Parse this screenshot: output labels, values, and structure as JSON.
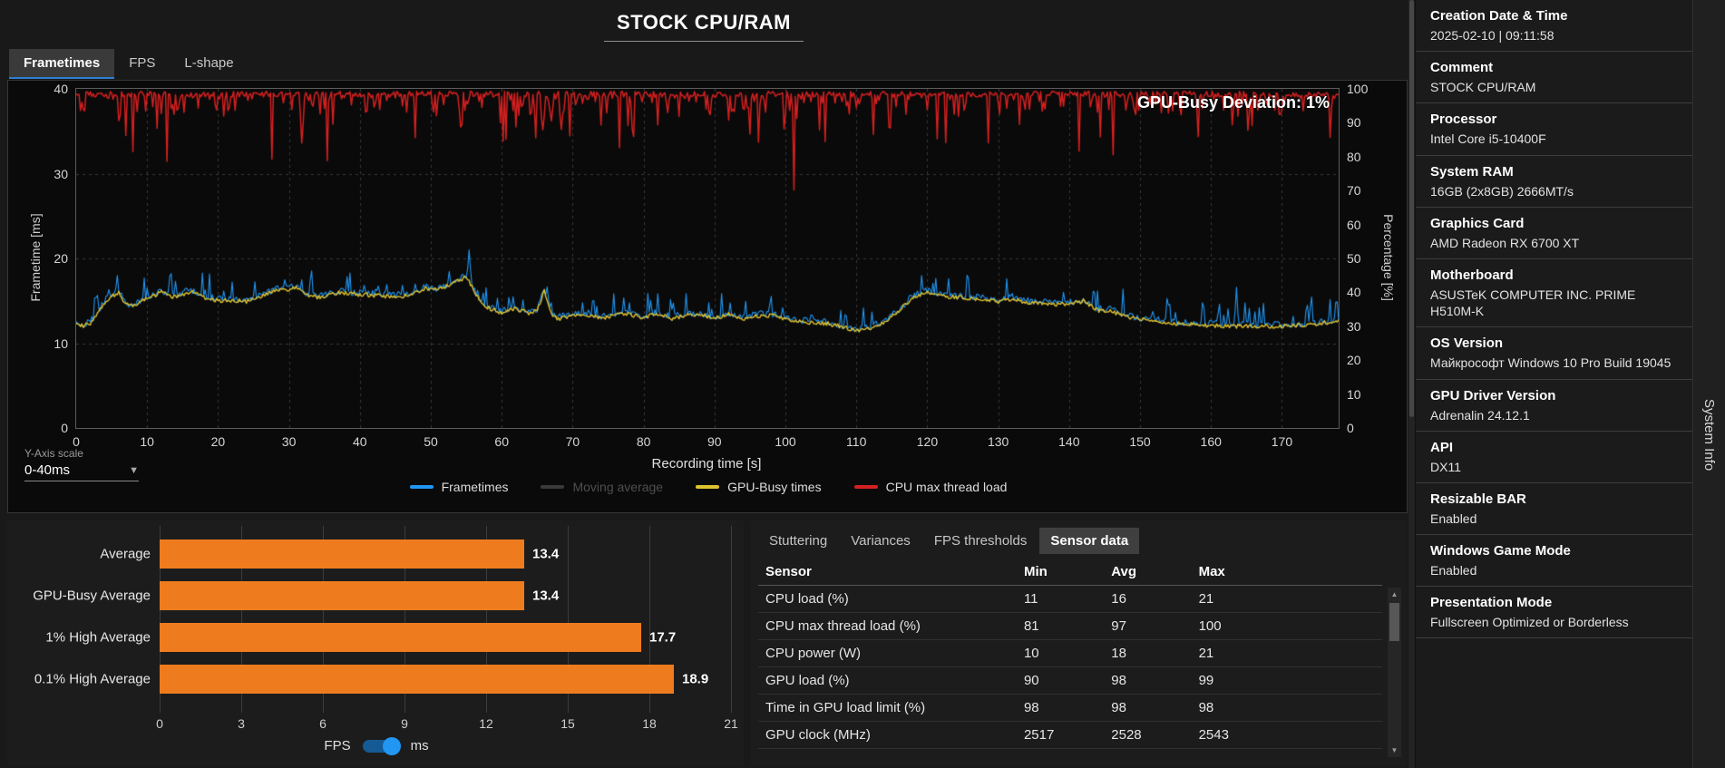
{
  "header": {
    "title": "STOCK CPU/RAM"
  },
  "view_tabs": [
    {
      "label": "Frametimes",
      "active": true
    },
    {
      "label": "FPS",
      "active": false
    },
    {
      "label": "L-shape",
      "active": false
    }
  ],
  "frametime_chart": {
    "type": "line",
    "overlay": "GPU-Busy Deviation: 1%",
    "seed": 20250210,
    "y_left": {
      "label": "Frametime [ms]",
      "ticks": [
        0,
        10,
        20,
        30,
        40
      ],
      "max": 40
    },
    "y_right": {
      "label": "Percentage [%]",
      "ticks": [
        0,
        10,
        20,
        30,
        40,
        50,
        60,
        70,
        80,
        90,
        100
      ],
      "max": 100
    },
    "x": {
      "label": "Recording time [s]",
      "ticks": [
        0,
        10,
        20,
        30,
        40,
        50,
        60,
        70,
        80,
        90,
        100,
        110,
        120,
        130,
        140,
        150,
        160,
        170
      ],
      "max": 178
    },
    "colors": {
      "frametimes": "#2196f3",
      "gpu_busy": "#e0c22e",
      "cpu_load": "#d42020",
      "moving_average": "#3a3a3a",
      "grid": "#383838"
    },
    "legend": [
      {
        "label": "Frametimes",
        "color": "#2196f3",
        "dim": false
      },
      {
        "label": "Moving average",
        "color": "#3a3a3a",
        "dim": true
      },
      {
        "label": "GPU-Busy times",
        "color": "#e0c22e",
        "dim": false
      },
      {
        "label": "CPU max thread load",
        "color": "#d42020",
        "dim": false
      }
    ],
    "baseline": [
      [
        0,
        12.2
      ],
      [
        1,
        12.0
      ],
      [
        2,
        12.4
      ],
      [
        3,
        13.4
      ],
      [
        4,
        14.8
      ],
      [
        5,
        15.6
      ],
      [
        6,
        15.9
      ],
      [
        7,
        14.6
      ],
      [
        8,
        14.3
      ],
      [
        9,
        14.9
      ],
      [
        10,
        15.3
      ],
      [
        12,
        16.0
      ],
      [
        14,
        15.4
      ],
      [
        16,
        16.1
      ],
      [
        18,
        15.4
      ],
      [
        20,
        15.0
      ],
      [
        22,
        15.1
      ],
      [
        24,
        14.9
      ],
      [
        26,
        15.4
      ],
      [
        28,
        16.2
      ],
      [
        30,
        16.3
      ],
      [
        31,
        16.5
      ],
      [
        33,
        15.5
      ],
      [
        35,
        15.4
      ],
      [
        37,
        16.0
      ],
      [
        39,
        15.8
      ],
      [
        41,
        15.7
      ],
      [
        43,
        15.6
      ],
      [
        45,
        15.5
      ],
      [
        47,
        15.6
      ],
      [
        49,
        16.4
      ],
      [
        51,
        16.3
      ],
      [
        53,
        17.0
      ],
      [
        55,
        17.8
      ],
      [
        56,
        16.3
      ],
      [
        57,
        15.0
      ],
      [
        58,
        14.2
      ],
      [
        60,
        13.6
      ],
      [
        62,
        14.1
      ],
      [
        64,
        13.5
      ],
      [
        65,
        13.8
      ],
      [
        66,
        16.2
      ],
      [
        67,
        13.4
      ],
      [
        68,
        12.9
      ],
      [
        70,
        13.2
      ],
      [
        72,
        13.4
      ],
      [
        74,
        12.9
      ],
      [
        76,
        13.3
      ],
      [
        78,
        13.4
      ],
      [
        80,
        13.0
      ],
      [
        82,
        13.5
      ],
      [
        84,
        12.9
      ],
      [
        86,
        13.3
      ],
      [
        88,
        13.4
      ],
      [
        90,
        12.9
      ],
      [
        92,
        13.4
      ],
      [
        94,
        12.9
      ],
      [
        96,
        13.2
      ],
      [
        98,
        13.3
      ],
      [
        100,
        12.9
      ],
      [
        102,
        12.5
      ],
      [
        104,
        12.4
      ],
      [
        106,
        12.3
      ],
      [
        108,
        11.9
      ],
      [
        110,
        11.5
      ],
      [
        112,
        11.8
      ],
      [
        114,
        12.4
      ],
      [
        116,
        13.8
      ],
      [
        118,
        15.4
      ],
      [
        120,
        16.0
      ],
      [
        122,
        15.5
      ],
      [
        124,
        15.4
      ],
      [
        126,
        15.3
      ],
      [
        128,
        15.2
      ],
      [
        130,
        14.9
      ],
      [
        132,
        15.3
      ],
      [
        134,
        14.8
      ],
      [
        136,
        14.7
      ],
      [
        138,
        14.6
      ],
      [
        140,
        14.6
      ],
      [
        142,
        15.0
      ],
      [
        144,
        13.9
      ],
      [
        146,
        13.8
      ],
      [
        148,
        13.1
      ],
      [
        150,
        12.8
      ],
      [
        154,
        12.4
      ],
      [
        158,
        12.2
      ],
      [
        162,
        12.0
      ],
      [
        166,
        12.0
      ],
      [
        170,
        12.0
      ],
      [
        174,
        12.2
      ],
      [
        178,
        12.6
      ]
    ],
    "spikes": [
      [
        5.8,
        18.0
      ],
      [
        55.4,
        21.0
      ],
      [
        163.5,
        16.6
      ]
    ]
  },
  "y_axis_scale": {
    "label": "Y-Axis scale",
    "value": "0-40ms",
    "caret": "▼"
  },
  "bar_chart": {
    "type": "bar",
    "rows": [
      {
        "label": "Average",
        "value": 13.4
      },
      {
        "label": "GPU-Busy Average",
        "value": 13.4
      },
      {
        "label": "1% High Average",
        "value": 17.7
      },
      {
        "label": "0.1% High Average",
        "value": 18.9
      }
    ],
    "x_ticks": [
      0,
      3,
      6,
      9,
      12,
      15,
      18,
      21
    ],
    "x_max": 21,
    "bar_color": "#ee7c1f",
    "toggle": {
      "left_label": "FPS",
      "right_label": "ms",
      "selected": "ms",
      "accent": "#2196f3"
    }
  },
  "sensor_panel": {
    "tabs": [
      {
        "label": "Stuttering",
        "active": false
      },
      {
        "label": "Variances",
        "active": false
      },
      {
        "label": "FPS thresholds",
        "active": false
      },
      {
        "label": "Sensor data",
        "active": true
      }
    ],
    "table": {
      "headers": [
        "Sensor",
        "Min",
        "Avg",
        "Max"
      ],
      "rows": [
        [
          "CPU load (%)",
          "11",
          "16",
          "21"
        ],
        [
          "CPU max thread load (%)",
          "81",
          "97",
          "100"
        ],
        [
          "CPU power (W)",
          "10",
          "18",
          "21"
        ],
        [
          "GPU load (%)",
          "90",
          "98",
          "99"
        ],
        [
          "Time in GPU load limit (%)",
          "98",
          "98",
          "98"
        ],
        [
          "GPU clock (MHz)",
          "2517",
          "2528",
          "2543"
        ]
      ],
      "scroll_up": "▲",
      "scroll_down": "▼"
    }
  },
  "system_info": {
    "panel_title": "System Info",
    "items": [
      {
        "label": "Creation Date & Time",
        "value": "2025-02-10 | 09:11:58"
      },
      {
        "label": "Comment",
        "value": "STOCK CPU/RAM"
      },
      {
        "label": "Processor",
        "value": "Intel Core i5-10400F"
      },
      {
        "label": "System RAM",
        "value": "16GB (2x8GB) 2666MT/s"
      },
      {
        "label": "Graphics Card",
        "value": "AMD Radeon RX 6700 XT"
      },
      {
        "label": "Motherboard",
        "value": "ASUSTeK COMPUTER INC. PRIME H510M-K"
      },
      {
        "label": "OS Version",
        "value": "Майкрософт Windows 10 Pro Build 19045"
      },
      {
        "label": "GPU Driver Version",
        "value": "Adrenalin 24.12.1"
      },
      {
        "label": "API",
        "value": "DX11"
      },
      {
        "label": "Resizable BAR",
        "value": "Enabled"
      },
      {
        "label": "Windows Game Mode",
        "value": "Enabled"
      },
      {
        "label": "Presentation Mode",
        "value": "Fullscreen Optimized or Borderless"
      }
    ]
  }
}
